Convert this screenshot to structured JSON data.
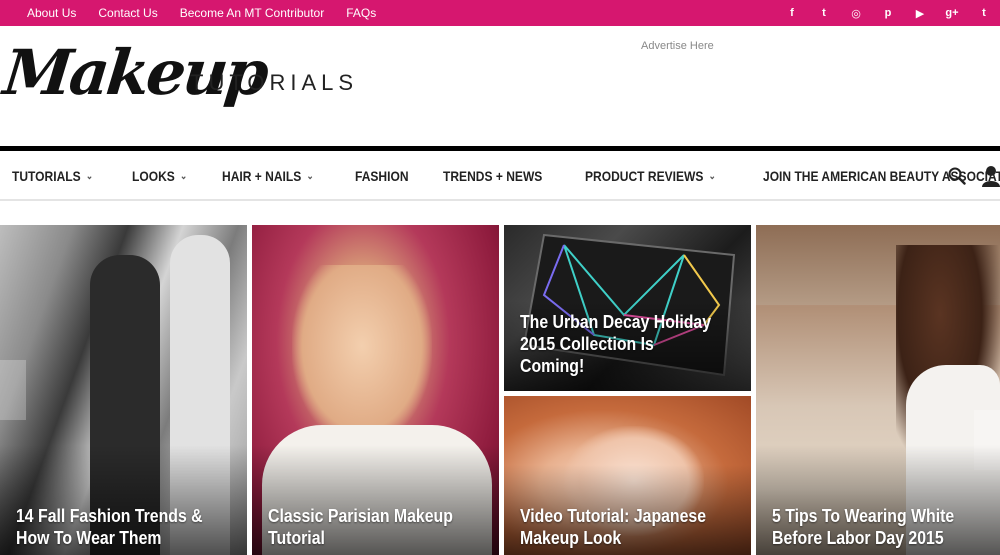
{
  "topbar": {
    "links": [
      "About Us",
      "Contact Us",
      "Become An MT Contributor",
      "FAQs"
    ],
    "social": [
      {
        "icon": "facebook-icon",
        "glyph": "f"
      },
      {
        "icon": "twitter-icon",
        "glyph": "t"
      },
      {
        "icon": "instagram-icon",
        "glyph": "◎"
      },
      {
        "icon": "pinterest-icon",
        "glyph": "p"
      },
      {
        "icon": "youtube-icon",
        "glyph": "▶"
      },
      {
        "icon": "googleplus-icon",
        "glyph": "g+"
      },
      {
        "icon": "tumblr-icon",
        "glyph": "t"
      }
    ],
    "color": "#d6176f"
  },
  "header": {
    "logo_script": "Makeup",
    "logo_sub": "TUTORIALS",
    "advert": "Advertise Here"
  },
  "nav": {
    "items": [
      {
        "label": "TUTORIALS",
        "dropdown": true
      },
      {
        "label": "LOOKS",
        "dropdown": true
      },
      {
        "label": "HAIR + NAILS",
        "dropdown": true
      },
      {
        "label": "FASHION",
        "dropdown": false
      },
      {
        "label": "TRENDS + NEWS",
        "dropdown": false
      },
      {
        "label": "PRODUCT REVIEWS",
        "dropdown": true
      },
      {
        "label": "JOIN THE AMERICAN BEAUTY ASSOCIATION",
        "dropdown": false
      }
    ],
    "search_icon": "search-icon",
    "user_icon": "user-icon"
  },
  "tiles": [
    {
      "caption": "14 Fall Fashion Trends & How To Wear Them"
    },
    {
      "caption": "Classic Parisian Makeup Tutorial"
    },
    {
      "caption": "The Urban Decay Holiday 2015 Collection Is Coming!"
    },
    {
      "caption": "Video Tutorial: Japanese Makeup Look"
    },
    {
      "caption": "5 Tips To Wearing White Before Labor Day 2015"
    }
  ]
}
